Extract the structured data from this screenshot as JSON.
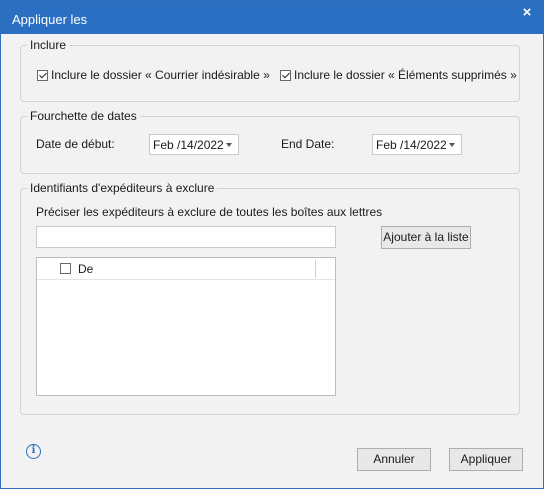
{
  "window": {
    "title": "Appliquer les",
    "close_glyph": "×"
  },
  "include": {
    "legend": "Inclure",
    "junk": {
      "label": "Inclure le dossier « Courrier indésirable »",
      "checked": true
    },
    "deleted": {
      "label": "Inclure le dossier « Éléments supprimés »",
      "checked": true
    }
  },
  "dates": {
    "legend": "Fourchette de dates",
    "start_label": "Date de début:",
    "start_value": "Feb /14/2022",
    "end_label": "End Date:",
    "end_value": "Feb /14/2022"
  },
  "senders": {
    "legend": "Identifiants d'expéditeurs à exclure",
    "instruction": "Préciser les expéditeurs à exclure de toutes les boîtes aux lettres",
    "input_value": "",
    "add_button": "Ajouter à la liste",
    "list_header_col": "De",
    "rows": []
  },
  "footer": {
    "info_icon": "info-icon",
    "cancel": "Annuler",
    "apply": "Appliquer"
  },
  "colors": {
    "titlebar": "#2b6fc3",
    "accent": "#2b6fc3",
    "dialog_bg": "#f2f2f2"
  }
}
